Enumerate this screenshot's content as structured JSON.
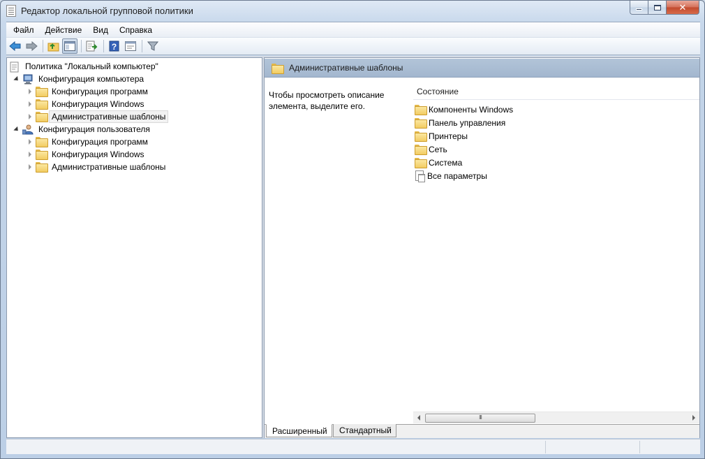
{
  "window": {
    "title": "Редактор локальной групповой политики"
  },
  "menu": [
    {
      "label": "Файл"
    },
    {
      "label": "Действие"
    },
    {
      "label": "Вид"
    },
    {
      "label": "Справка"
    }
  ],
  "toolbar": {
    "buttons": [
      "back-arrow-icon",
      "forward-arrow-icon",
      "up-folder-icon",
      "show-hide-tree-icon",
      "export-list-icon",
      "help-icon",
      "properties-icon",
      "filter-icon"
    ]
  },
  "tree": {
    "root": "Политика \"Локальный компьютер\"",
    "computer": {
      "label": "Конфигурация компьютера",
      "children": [
        "Конфигурация программ",
        "Конфигурация Windows",
        "Административные шаблоны"
      ]
    },
    "user": {
      "label": "Конфигурация пользователя",
      "children": [
        "Конфигурация программ",
        "Конфигурация Windows",
        "Административные шаблоны"
      ]
    }
  },
  "details": {
    "header": "Административные шаблоны",
    "description": "Чтобы просмотреть описание элемента, выделите его.",
    "column_header": "Состояние",
    "items": [
      "Компоненты Windows",
      "Панель управления",
      "Принтеры",
      "Сеть",
      "Система",
      "Все параметры"
    ],
    "scroll_grip": "III"
  },
  "tabs": {
    "extended": "Расширенный",
    "standard": "Стандартный"
  }
}
